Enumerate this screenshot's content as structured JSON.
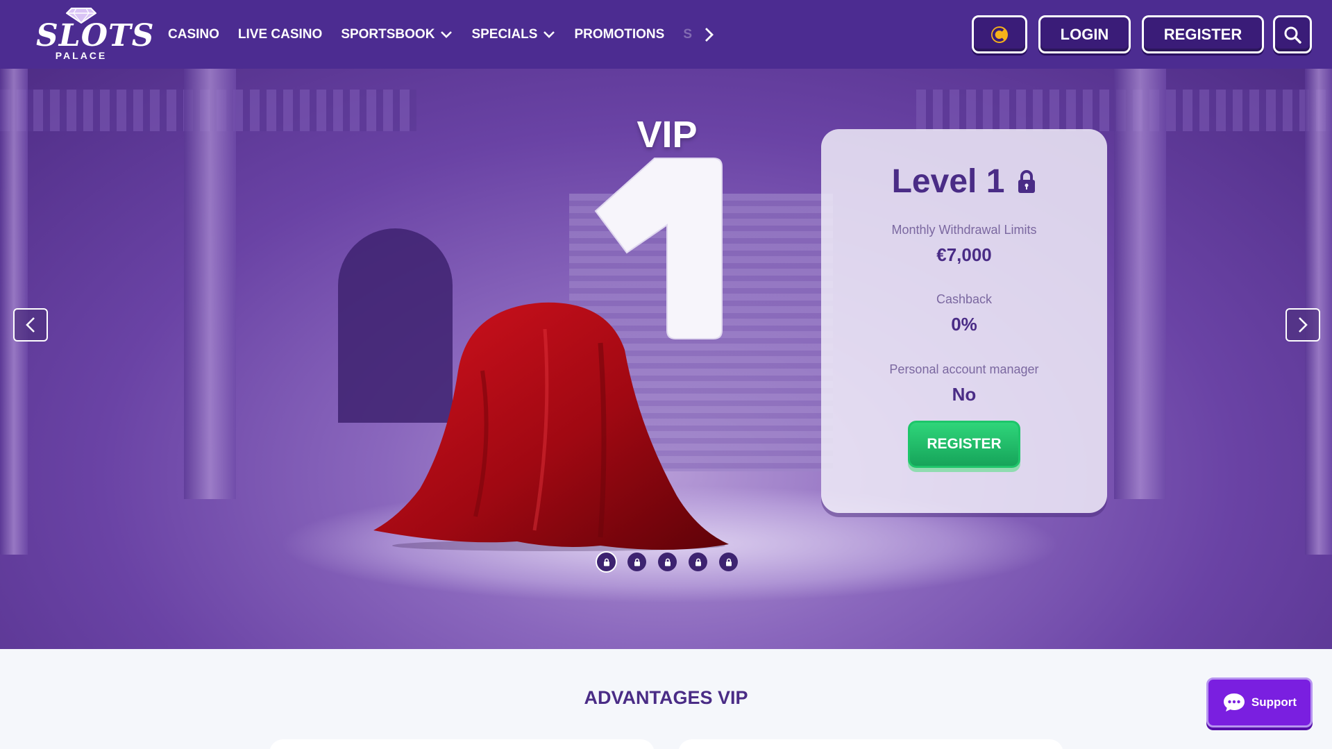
{
  "header": {
    "logo_main": "SLOTS",
    "logo_sub": "PALACE",
    "nav": [
      "CASINO",
      "LIVE CASINO",
      "SPORTSBOOK",
      "SPECIALS",
      "PROMOTIONS"
    ],
    "nav_faded": "S",
    "login_label": "LOGIN",
    "register_label": "REGISTER"
  },
  "hero": {
    "title": "VIP",
    "big_number": "1",
    "slide_count": 5,
    "active_slide": 1
  },
  "level_card": {
    "title": "Level 1",
    "withdrawal_label": "Monthly Withdrawal Limits",
    "withdrawal_value": "€7,000",
    "cashback_label": "Cashback",
    "cashback_value": "0%",
    "manager_label": "Personal account manager",
    "manager_value": "No",
    "register_label": "REGISTER"
  },
  "advantages": {
    "title": "ADVANTAGES VIP"
  },
  "support": {
    "label": "Support"
  },
  "colors": {
    "header_bg": "#4c2c91",
    "accent_green": "#22c06a",
    "text_purple": "#4a2c86",
    "support_bg": "#7a1fe0"
  },
  "icons": [
    "diamond-icon",
    "chevron-down-icon",
    "chevron-right-icon",
    "coin-icon",
    "search-icon",
    "lock-icon",
    "chat-bubble-icon"
  ]
}
